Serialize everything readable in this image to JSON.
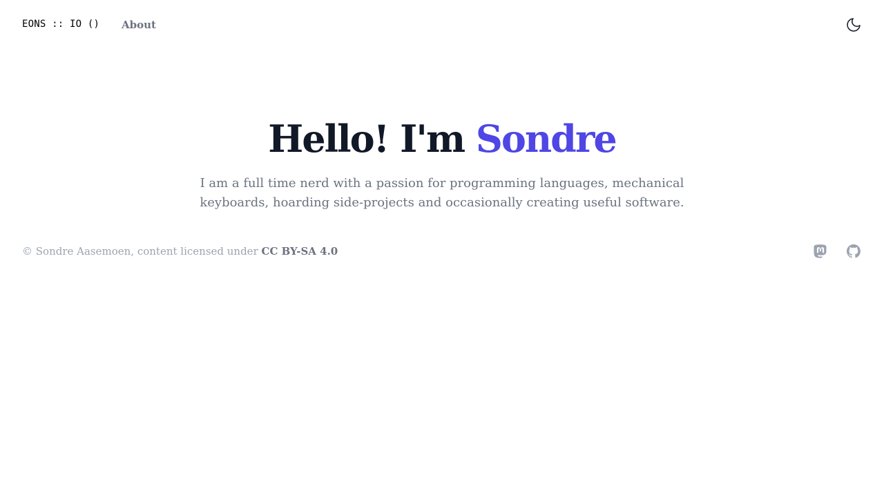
{
  "header": {
    "brand": "EONS :: IO ()",
    "nav": [
      {
        "label": "About"
      }
    ],
    "theme_toggle_icon": "moon-icon"
  },
  "hero": {
    "title_prefix": "Hello! I'm ",
    "title_name": "Sondre",
    "subtitle": "I am a full time nerd with a passion for programming languages, mechanical keyboards, hoarding side-projects and occasionally creating useful software."
  },
  "footer": {
    "copyright_text": "© Sondre Aasemoen, content licensed under ",
    "license_label": "CC BY-SA 4.0",
    "social": [
      {
        "icon": "mastodon-icon"
      },
      {
        "icon": "github-icon"
      }
    ]
  },
  "colors": {
    "accent": "#4f46e5",
    "heading": "#111827",
    "muted": "#6b7280",
    "footer_text": "#9ca3af",
    "background": "#ffffff"
  }
}
